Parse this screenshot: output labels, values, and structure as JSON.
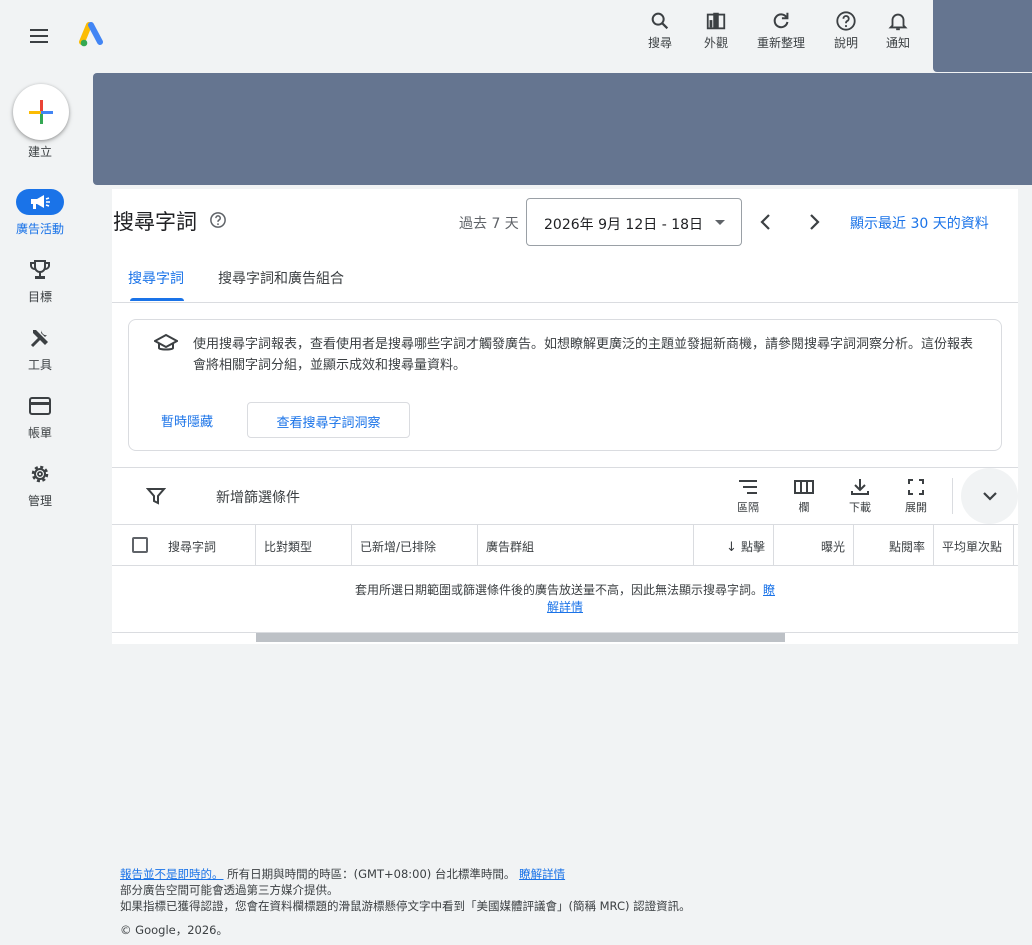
{
  "header": {
    "tools": [
      {
        "label": "搜尋",
        "icon": "search-icon"
      },
      {
        "label": "外觀",
        "icon": "appearance-icon"
      },
      {
        "label": "重新整理",
        "icon": "refresh-icon"
      },
      {
        "label": "說明",
        "icon": "help-icon"
      },
      {
        "label": "通知",
        "icon": "bell-icon"
      }
    ]
  },
  "sidenav": {
    "create_label": "建立",
    "items": [
      {
        "label": "廣告活動",
        "icon": "campaign-megaphone-icon",
        "active": true
      },
      {
        "label": "目標",
        "icon": "trophy-icon",
        "active": false
      },
      {
        "label": "工具",
        "icon": "tools-icon",
        "active": false
      },
      {
        "label": "帳單",
        "icon": "credit-card-icon",
        "active": false
      },
      {
        "label": "管理",
        "icon": "gear-icon",
        "active": false
      }
    ]
  },
  "page": {
    "title": "搜尋字詞",
    "date_range_label": "過去 7 天",
    "date_range_value": "2026年 9月 12日 - 18日",
    "show_30_days": "顯示最近 30 天的資料"
  },
  "tabs": [
    {
      "label": "搜尋字詞",
      "active": true
    },
    {
      "label": "搜尋字詞和廣告組合",
      "active": false
    }
  ],
  "info": {
    "text": "使用搜尋字詞報表，查看使用者是搜尋哪些字詞才觸發廣告。如想瞭解更廣泛的主題並發掘新商機，請參閱搜尋字詞洞察分析。這份報表會將相關字詞分組，並顯示成效和搜尋量資料。",
    "dismiss_label": "暫時隱藏",
    "insights_button": "查看搜尋字詞洞察"
  },
  "toolbar": {
    "filter_label": "新增篩選條件",
    "segment_label": "區隔",
    "columns_label": "欄",
    "download_label": "下載",
    "expand_label": "展開"
  },
  "table": {
    "columns": [
      "搜尋字詞",
      "比對類型",
      "已新增/已排除",
      "廣告群組",
      "點擊",
      "曝光",
      "點閱率",
      "平均單次點"
    ],
    "empty_message": "套用所選日期範圍或篩選條件後的廣告放送量不高，因此無法顯示搜尋字詞。",
    "empty_link": "瞭解詳情"
  },
  "footer": {
    "line1_link": "報告並不是即時的。",
    "line1_text": " 所有日期與時間的時區：(GMT+08:00) 台北標準時間。 ",
    "line1_link2": "瞭解詳情",
    "line2": "部分廣告空間可能會透過第三方媒介提供。",
    "line3": "如果指標已獲得認證，您會在資料欄標題的滑鼠游標懸停文字中看到「美國媒體評議會」(簡稱 MRC) 認證資訊。",
    "copyright": "© Google，2026。"
  },
  "colors": {
    "accent": "#1a73e8",
    "redacted_block": "#657590",
    "active_nav_pill": "#1a73e8"
  }
}
